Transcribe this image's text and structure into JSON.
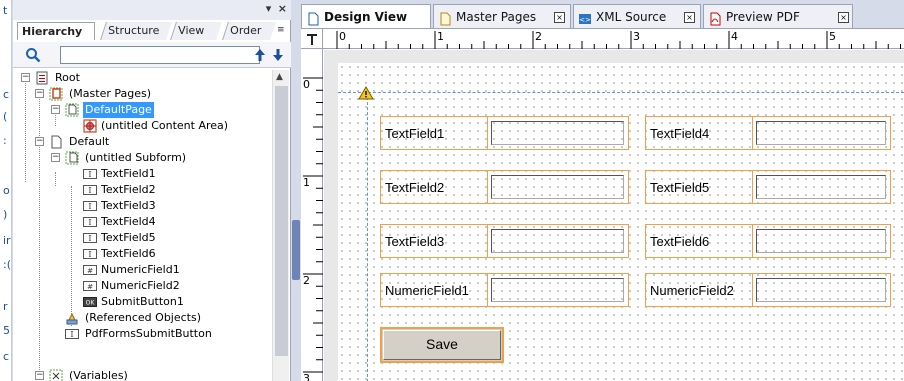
{
  "left_strip": {
    "chars": [
      "t",
      "c",
      "(",
      ":",
      "o",
      ")",
      "ir",
      ":(",
      "r",
      "5",
      "c"
    ]
  },
  "panel": {
    "tabs": [
      {
        "label": "Hierarchy",
        "active": true
      },
      {
        "label": "Structure",
        "active": false
      },
      {
        "label": "View",
        "active": false
      },
      {
        "label": "Order",
        "active": false
      }
    ],
    "search": {
      "value": "",
      "placeholder": ""
    },
    "tree": [
      {
        "label": "Root",
        "icon": "root-icon"
      },
      {
        "label": "(Master Pages)",
        "icon": "master-pages-icon"
      },
      {
        "label": "DefaultPage",
        "icon": "page-icon",
        "selected": true
      },
      {
        "label": "(untitled Content Area)",
        "icon": "content-area-icon"
      },
      {
        "label": "Default",
        "icon": "page-icon"
      },
      {
        "label": "(untitled Subform)",
        "icon": "subform-icon"
      },
      {
        "label": "TextField1",
        "icon": "text-field-icon"
      },
      {
        "label": "TextField2",
        "icon": "text-field-icon"
      },
      {
        "label": "TextField3",
        "icon": "text-field-icon"
      },
      {
        "label": "TextField4",
        "icon": "text-field-icon"
      },
      {
        "label": "TextField5",
        "icon": "text-field-icon"
      },
      {
        "label": "TextField6",
        "icon": "text-field-icon"
      },
      {
        "label": "NumericField1",
        "icon": "numeric-field-icon"
      },
      {
        "label": "NumericField2",
        "icon": "numeric-field-icon"
      },
      {
        "label": "SubmitButton1",
        "icon": "button-icon"
      },
      {
        "label": "(Referenced Objects)",
        "icon": "referenced-objects-icon"
      },
      {
        "label": "PdfFormsSubmitButton",
        "icon": "text-field-icon"
      },
      {
        "label": "(Variables)",
        "icon": "variables-icon"
      }
    ]
  },
  "doc_tabs": [
    {
      "label": "Design View",
      "active": true,
      "icon": "page-icon"
    },
    {
      "label": "Master Pages",
      "active": false,
      "icon": "page-icon"
    },
    {
      "label": "XML Source",
      "active": false,
      "icon": "xml-icon"
    },
    {
      "label": "Preview PDF",
      "active": false,
      "icon": "pdf-icon"
    }
  ],
  "ruler": {
    "h_labels": [
      "0",
      "1",
      "2",
      "3",
      "4",
      "5"
    ],
    "v_labels": [
      "0",
      "1",
      "2",
      "3"
    ]
  },
  "form": {
    "fields": [
      {
        "caption": "TextField1"
      },
      {
        "caption": "TextField4"
      },
      {
        "caption": "TextField2"
      },
      {
        "caption": "TextField5"
      },
      {
        "caption": "TextField3"
      },
      {
        "caption": "TextField6"
      },
      {
        "caption": "NumericField1"
      },
      {
        "caption": "NumericField2"
      }
    ],
    "save_label": "Save"
  },
  "colors": {
    "selection": "#3399ff",
    "field_border": "#f0a04a",
    "guide": "#6a8fd0",
    "splitter": "#6f84b6"
  }
}
